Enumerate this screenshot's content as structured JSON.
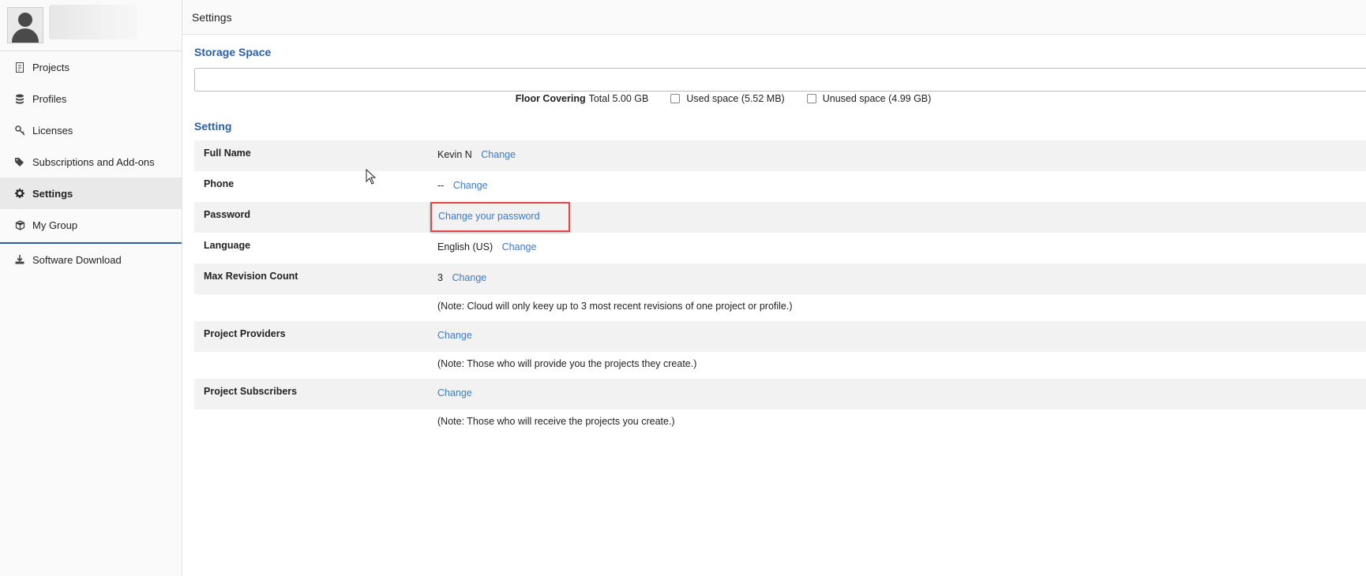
{
  "header": {
    "title": "Settings"
  },
  "sidebar": {
    "items": [
      {
        "label": "Projects",
        "icon": "project-file-icon",
        "active": false
      },
      {
        "label": "Profiles",
        "icon": "database-icon",
        "active": false
      },
      {
        "label": "Licenses",
        "icon": "key-icon",
        "active": false
      },
      {
        "label": "Subscriptions and Add-ons",
        "icon": "tags-icon",
        "active": false
      },
      {
        "label": "Settings",
        "icon": "gear-icon",
        "active": true
      },
      {
        "label": "My Group",
        "icon": "cubes-icon",
        "active": false
      }
    ],
    "download": {
      "label": "Software Download",
      "icon": "download-icon"
    }
  },
  "storage": {
    "title": "Storage Space",
    "name": "Floor Covering",
    "total": "Total 5.00 GB",
    "used": "Used space (5.52 MB)",
    "unused": "Unused space (4.99 GB)"
  },
  "setting": {
    "title": "Setting",
    "full_name": {
      "label": "Full Name",
      "value": "Kevin N",
      "action": "Change"
    },
    "phone": {
      "label": "Phone",
      "value": "--",
      "action": "Change"
    },
    "password": {
      "label": "Password",
      "action": "Change your password"
    },
    "language": {
      "label": "Language",
      "value": "English (US)",
      "action": "Change"
    },
    "max_revision": {
      "label": "Max Revision Count",
      "value": "3",
      "action": "Change",
      "note": "(Note: Cloud will only keey up to 3 most recent revisions of one project or profile.)"
    },
    "providers": {
      "label": "Project Providers",
      "action": "Change",
      "note": "(Note: Those who will provide you the projects they create.)"
    },
    "subscribers": {
      "label": "Project Subscribers",
      "action": "Change",
      "note": "(Note: Those who will receive the projects you create.)"
    }
  },
  "colors": {
    "accent": "#2b5fa6",
    "link": "#3a7bc8",
    "highlight_box": "#e04848"
  }
}
